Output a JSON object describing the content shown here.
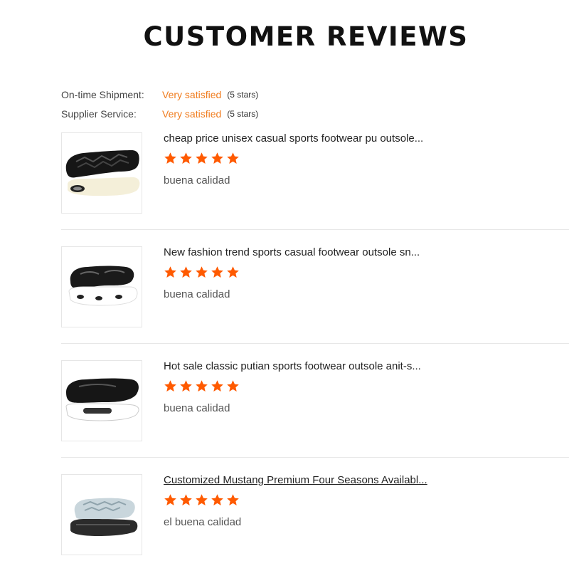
{
  "page": {
    "title": "CUSTOMER REVIEWS"
  },
  "ratings": [
    {
      "label": "On-time Shipment:",
      "value": "Very satisfied",
      "stars": "(5 stars)"
    },
    {
      "label": "Supplier Service:",
      "value": "Very satisfied",
      "stars": "(5 stars)"
    }
  ],
  "reviews": [
    {
      "title": "cheap price unisex casual sports footwear pu outsole...",
      "rating": 5,
      "comment": "buena calidad",
      "thumbnail": "black-white-shoe-sole"
    },
    {
      "title": "New fashion trend sports casual footwear outsole sn...",
      "rating": 5,
      "comment": "buena calidad",
      "thumbnail": "black-white-air-sole"
    },
    {
      "title": "Hot sale classic putian sports footwear outsole anit-s...",
      "rating": 5,
      "comment": "buena calidad",
      "thumbnail": "black-white-air-sole"
    },
    {
      "title": "Customized Mustang Premium Four Seasons Availabl...",
      "rating": 5,
      "comment": "el buena calidad",
      "thumbnail": "grey-black-shoe-sole"
    }
  ],
  "colors": {
    "accent": "#f07c1e",
    "star": "#ff5a00",
    "divider": "#e7e7e7"
  },
  "icons": {
    "star": "star-icon"
  }
}
